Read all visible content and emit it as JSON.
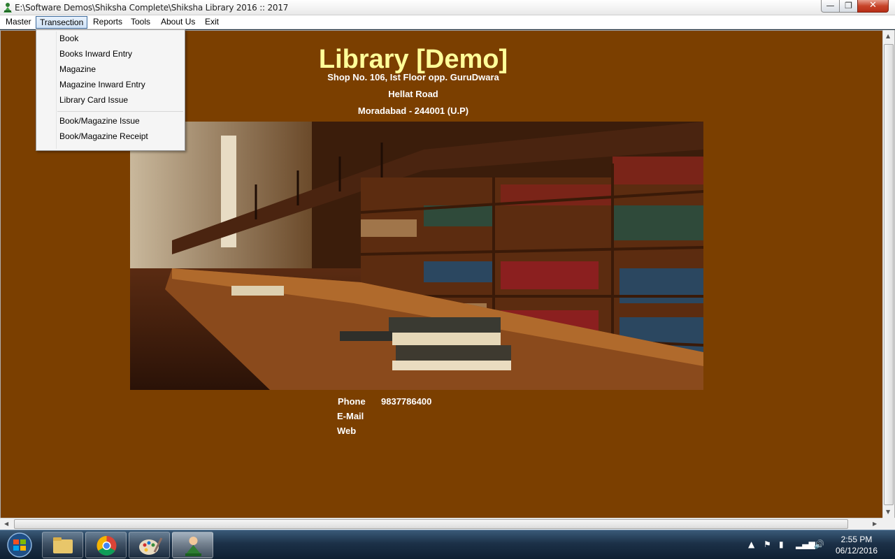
{
  "window": {
    "title": "E:\\Software Demos\\Shiksha Complete\\Shiksha Library 2016 :: 2017",
    "minimize_glyph": "—",
    "maximize_glyph": "❐",
    "close_glyph": "✕"
  },
  "menu": {
    "items": [
      "Master",
      "Transection",
      "Reports",
      "Tools",
      "About Us",
      "Exit"
    ],
    "active": "Transection"
  },
  "dropdown": {
    "items": [
      "Book",
      "Books Inward Entry",
      "Magazine",
      "Magazine Inward Entry",
      "Library Card Issue",
      "Book/Magazine Issue",
      "Book/Magazine Receipt"
    ]
  },
  "header": {
    "title": "Library [Demo]",
    "address_line1": "Shop No. 106, Ist Floor opp. GuruDwara",
    "address_line2": "Hellat Road",
    "address_line3": "Moradabad - 244001 (U.P)"
  },
  "contact": {
    "phone_label": "Phone",
    "phone_value": "9837786400",
    "email_label": "E-Mail",
    "web_label": "Web"
  },
  "taskbar": {
    "time": "2:55 PM",
    "date": "06/12/2016"
  },
  "colors": {
    "background": "#7b3f00",
    "title_accent": "#ffff99"
  }
}
